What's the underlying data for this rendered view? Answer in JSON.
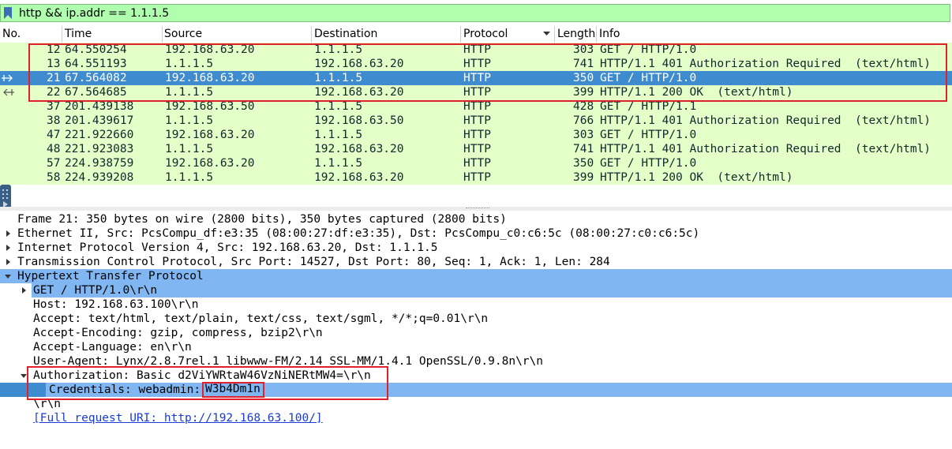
{
  "filter": {
    "text": "http && ip.addr == 1.1.1.5",
    "bookmark_icon": "bookmark-icon",
    "valid_color": "#afffaf"
  },
  "packet_list": {
    "columns": [
      "No.",
      "Time",
      "Source",
      "Destination",
      "Protocol",
      "Length",
      "Info"
    ],
    "sort_column": "Protocol",
    "row_color": "#e4ffc7",
    "selected_color": "#3f8bd0",
    "rows": [
      {
        "no": "12",
        "time": "64.550254",
        "src": "192.168.63.20",
        "dst": "1.1.1.5",
        "proto": "HTTP",
        "len": "303",
        "info": "GET / HTTP/1.0"
      },
      {
        "no": "13",
        "time": "64.551193",
        "src": "1.1.1.5",
        "dst": "192.168.63.20",
        "proto": "HTTP",
        "len": "741",
        "info": "HTTP/1.1 401 Authorization Required  (text/html)"
      },
      {
        "no": "21",
        "time": "67.564082",
        "src": "192.168.63.20",
        "dst": "1.1.1.5",
        "proto": "HTTP",
        "len": "350",
        "info": "GET / HTTP/1.0"
      },
      {
        "no": "22",
        "time": "67.564685",
        "src": "1.1.1.5",
        "dst": "192.168.63.20",
        "proto": "HTTP",
        "len": "399",
        "info": "HTTP/1.1 200 OK  (text/html)"
      },
      {
        "no": "37",
        "time": "201.439138",
        "src": "192.168.63.50",
        "dst": "1.1.1.5",
        "proto": "HTTP",
        "len": "428",
        "info": "GET / HTTP/1.1"
      },
      {
        "no": "38",
        "time": "201.439617",
        "src": "1.1.1.5",
        "dst": "192.168.63.50",
        "proto": "HTTP",
        "len": "766",
        "info": "HTTP/1.1 401 Authorization Required  (text/html)"
      },
      {
        "no": "47",
        "time": "221.922660",
        "src": "192.168.63.20",
        "dst": "1.1.1.5",
        "proto": "HTTP",
        "len": "303",
        "info": "GET / HTTP/1.0"
      },
      {
        "no": "48",
        "time": "221.923083",
        "src": "1.1.1.5",
        "dst": "192.168.63.20",
        "proto": "HTTP",
        "len": "741",
        "info": "HTTP/1.1 401 Authorization Required  (text/html)"
      },
      {
        "no": "57",
        "time": "224.938759",
        "src": "192.168.63.20",
        "dst": "1.1.1.5",
        "proto": "HTTP",
        "len": "350",
        "info": "GET / HTTP/1.0"
      },
      {
        "no": "58",
        "time": "224.939208",
        "src": "1.1.1.5",
        "dst": "192.168.63.20",
        "proto": "HTTP",
        "len": "399",
        "info": "HTTP/1.1 200 OK  (text/html)"
      }
    ]
  },
  "details": {
    "frame": "Frame 21: 350 bytes on wire (2800 bits), 350 bytes captured (2800 bits)",
    "ethernet": "Ethernet II, Src: PcsCompu_df:e3:35 (08:00:27:df:e3:35), Dst: PcsCompu_c0:c6:5c (08:00:27:c0:c6:5c)",
    "ip": "Internet Protocol Version 4, Src: 192.168.63.20, Dst: 1.1.1.5",
    "tcp": "Transmission Control Protocol, Src Port: 14527, Dst Port: 80, Seq: 1, Ack: 1, Len: 284",
    "http": "Hypertext Transfer Protocol",
    "request_line": "GET / HTTP/1.0\\r\\n",
    "host": "Host: 192.168.63.100\\r\\n",
    "accept": "Accept: text/html, text/plain, text/css, text/sgml, */*;q=0.01\\r\\n",
    "accept_encoding": "Accept-Encoding: gzip, compress, bzip2\\r\\n",
    "accept_language": "Accept-Language: en\\r\\n",
    "user_agent": "User-Agent: Lynx/2.8.7rel.1 libwww-FM/2.14 SSL-MM/1.4.1 OpenSSL/0.9.8n\\r\\n",
    "authorization": "Authorization: Basic d2ViYWRtaW46VzNiNERtMW4=\\r\\n",
    "credentials_label": "Credentials: webadmin:",
    "credentials_password": "W3b4Dm1n",
    "crlf": "\\r\\n",
    "full_uri": "[Full request URI: http://192.168.63.100/]"
  }
}
